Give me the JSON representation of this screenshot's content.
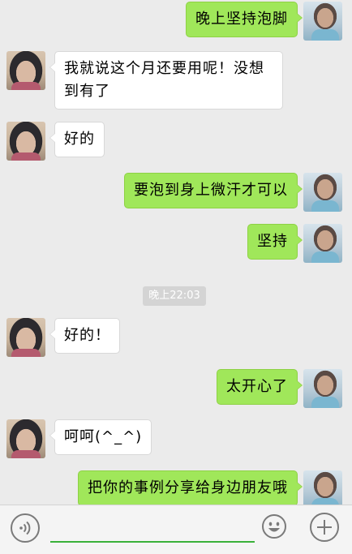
{
  "messages": [
    {
      "side": "right",
      "text": "晚上坚持泡脚"
    },
    {
      "side": "left",
      "text": "我就说这个月还要用呢！没想到有了"
    },
    {
      "side": "left",
      "text": "好的"
    },
    {
      "side": "right",
      "text": "要泡到身上微汗才可以"
    },
    {
      "side": "right",
      "text": "坚持"
    },
    {
      "side": "left",
      "text": "好的！"
    },
    {
      "side": "right",
      "text": "太开心了"
    },
    {
      "side": "left",
      "text": "呵呵(^_^)"
    },
    {
      "side": "right",
      "text": "把你的事例分享给身边朋友哦"
    }
  ],
  "timestamp": "晚上22:03",
  "input_bar": {
    "voice_icon": "voice-icon",
    "emoji_icon": "emoji-icon",
    "plus_icon": "plus-icon",
    "input_value": ""
  },
  "colors": {
    "background": "#ebebeb",
    "sent_bubble": "#a0e75a",
    "received_bubble": "#ffffff",
    "input_underline": "#3ab13a"
  }
}
